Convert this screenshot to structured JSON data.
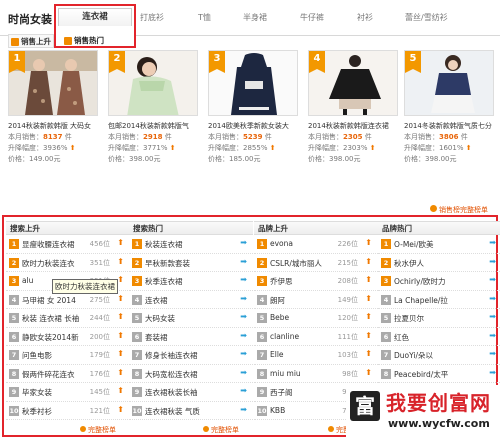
{
  "tabs": {
    "brand": "时尚女装",
    "active": "连衣裙",
    "items": [
      "打底衫",
      "T恤",
      "半身裙",
      "牛仔裤",
      "衬衫",
      "蕾丝/雪纺衫"
    ]
  },
  "subtabs": [
    "销售上升",
    "销售热门"
  ],
  "products": [
    {
      "rank": "1",
      "name": "2014秋装新款韩版 大码女",
      "sales_label": "本月销售：",
      "sales": "8137",
      "sales_unit": "件",
      "growth_label": "升降幅度：",
      "growth": "3936%",
      "price_label": "价格：",
      "price": "149.00元"
    },
    {
      "rank": "2",
      "name": "包邮2014秋装新款韩版气",
      "sales_label": "本月销售：",
      "sales": "2918",
      "sales_unit": "件",
      "growth_label": "升降幅度：",
      "growth": "3771%",
      "price_label": "价格：",
      "price": "398.00元"
    },
    {
      "rank": "3",
      "name": "2014欧美秋季新款女装大",
      "sales_label": "本月销售：",
      "sales": "5239",
      "sales_unit": "件",
      "growth_label": "升降幅度：",
      "growth": "2855%",
      "price_label": "价格：",
      "price": "185.00元"
    },
    {
      "rank": "4",
      "name": "2014秋装新款韩版连衣裙",
      "sales_label": "本月销售：",
      "sales": "2305",
      "sales_unit": "件",
      "growth_label": "升降幅度：",
      "growth": "2303%",
      "price_label": "价格：",
      "price": "398.00元"
    },
    {
      "rank": "5",
      "name": "2014冬装新款韩版气质七分",
      "sales_label": "本月销售：",
      "sales": "3806",
      "sales_unit": "件",
      "growth_label": "升降幅度：",
      "growth": "1601%",
      "price_label": "价格：",
      "price": "398.00元"
    }
  ],
  "more_top": "销售榜完整榜单",
  "rank_columns": [
    {
      "title": "搜索上升",
      "more": "完整榜单",
      "arrow": "up",
      "rows": [
        {
          "n": "1",
          "k": "显瘦收腰连衣裙",
          "c": "456位"
        },
        {
          "n": "2",
          "k": "欧时力秋装连衣",
          "c": "351位"
        },
        {
          "n": "3",
          "k": "alu",
          "c": "351位"
        },
        {
          "n": "4",
          "k": "马甲裙 女 2014",
          "c": "275位"
        },
        {
          "n": "5",
          "k": "秋装 连衣裙 长袖",
          "c": "244位"
        },
        {
          "n": "6",
          "k": "静欧女装2014新",
          "c": "200位"
        },
        {
          "n": "7",
          "k": "问鱼电影",
          "c": "179位"
        },
        {
          "n": "8",
          "k": "假两件碎花连衣",
          "c": "176位"
        },
        {
          "n": "9",
          "k": "毕家女装",
          "c": "145位"
        },
        {
          "n": "10",
          "k": "秋季衬衫",
          "c": "121位"
        }
      ]
    },
    {
      "title": "搜索热门",
      "more": "完整榜单",
      "arrow": "right",
      "rows": [
        {
          "n": "1",
          "k": "秋装连衣裙",
          "c": ""
        },
        {
          "n": "2",
          "k": "早秋新款套装",
          "c": ""
        },
        {
          "n": "3",
          "k": "秋季连衣裙",
          "c": ""
        },
        {
          "n": "4",
          "k": "连衣裙",
          "c": ""
        },
        {
          "n": "5",
          "k": "大码女装",
          "c": ""
        },
        {
          "n": "6",
          "k": "套装裙",
          "c": ""
        },
        {
          "n": "7",
          "k": "修身长袖连衣裙",
          "c": ""
        },
        {
          "n": "8",
          "k": "大码宽松连衣裙",
          "c": ""
        },
        {
          "n": "9",
          "k": "连衣裙秋装长袖",
          "c": ""
        },
        {
          "n": "10",
          "k": "连衣裙秋装 气质",
          "c": ""
        }
      ]
    },
    {
      "title": "品牌上升",
      "more": "完整榜单",
      "arrow": "up",
      "rows": [
        {
          "n": "1",
          "k": "evona",
          "c": "226位"
        },
        {
          "n": "2",
          "k": "CSLR/城市丽人",
          "c": "215位"
        },
        {
          "n": "3",
          "k": "乔伊思",
          "c": "208位"
        },
        {
          "n": "4",
          "k": "朗阿",
          "c": "149位"
        },
        {
          "n": "5",
          "k": "Bebe",
          "c": "120位"
        },
        {
          "n": "6",
          "k": "clanline",
          "c": "111位"
        },
        {
          "n": "7",
          "k": "Elle",
          "c": "103位"
        },
        {
          "n": "8",
          "k": "miu miu",
          "c": "98位"
        },
        {
          "n": "9",
          "k": "西子阁",
          "c": "94位"
        },
        {
          "n": "10",
          "k": "KBB",
          "c": "77位"
        }
      ]
    },
    {
      "title": "品牌热门",
      "more": "完整榜单",
      "arrow": "right",
      "rows": [
        {
          "n": "1",
          "k": "O-Mei/欧美",
          "c": ""
        },
        {
          "n": "2",
          "k": "秋水伊人",
          "c": ""
        },
        {
          "n": "3",
          "k": "Ochirly/欧时力",
          "c": ""
        },
        {
          "n": "4",
          "k": "La Chapelle/拉",
          "c": ""
        },
        {
          "n": "5",
          "k": "拉夏贝尔",
          "c": ""
        },
        {
          "n": "6",
          "k": "红色",
          "c": ""
        },
        {
          "n": "7",
          "k": "DuoYi/朵以",
          "c": ""
        },
        {
          "n": "8",
          "k": "Peacebird/太平",
          "c": ""
        },
        {
          "n": "9",
          "k": "",
          "c": ""
        },
        {
          "n": "10",
          "k": "",
          "c": ""
        }
      ]
    }
  ],
  "tooltip": "欧时力秋装连衣裙",
  "watermark": {
    "text": "我要创富网",
    "url": "www.wycfw.com"
  },
  "colors": {
    "accent": "#e2242b",
    "orange": "#f08a00",
    "price": "#e8650a"
  }
}
